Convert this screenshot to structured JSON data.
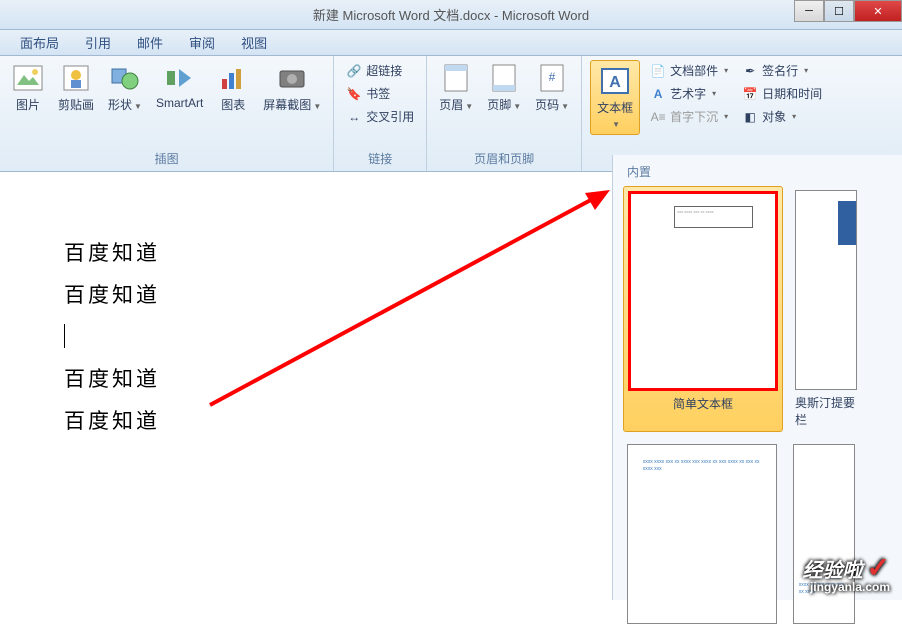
{
  "title": "新建 Microsoft Word 文档.docx - Microsoft Word",
  "tabs": [
    "面布局",
    "引用",
    "邮件",
    "审阅",
    "视图"
  ],
  "ribbon": {
    "illustrations": {
      "label": "插图",
      "picture": "图片",
      "clipart": "剪贴画",
      "shapes": "形状",
      "smartart": "SmartArt",
      "chart": "图表",
      "screenshot": "屏幕截图"
    },
    "links": {
      "label": "链接",
      "hyperlink": "超链接",
      "bookmark": "书签",
      "crossref": "交叉引用"
    },
    "headerfooter": {
      "label": "页眉和页脚",
      "header": "页眉",
      "footer": "页脚",
      "pagenum": "页码"
    },
    "text": {
      "textbox": "文本框",
      "quickparts": "文档部件",
      "wordart": "艺术字",
      "dropcap": "首字下沉",
      "sigline": "签名行",
      "datetime": "日期和时间",
      "object": "对象"
    }
  },
  "document": {
    "lines": [
      "百度知道",
      "百度知道",
      "",
      "百度知道",
      "百度知道"
    ]
  },
  "gallery": {
    "header": "内置",
    "items": [
      {
        "label": "简单文本框",
        "selected": true
      },
      {
        "label": "奥斯汀提要栏",
        "selected": false
      }
    ]
  },
  "watermark": {
    "main": "经验啦",
    "sub": "jingyanla.com"
  }
}
